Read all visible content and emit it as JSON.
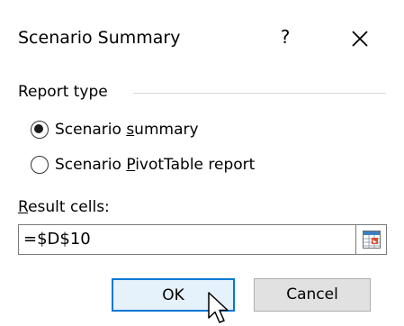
{
  "dialog": {
    "title": "Scenario Summary",
    "help_label": "?",
    "close_icon": "close-icon"
  },
  "report_type": {
    "group_label": "Report type",
    "options": [
      {
        "label": "Scenario summary",
        "underlined_char": "s",
        "selected": true
      },
      {
        "label": "Scenario PivotTable report",
        "underlined_char": "P",
        "selected": false
      }
    ]
  },
  "result_cells": {
    "label": "Result cells:",
    "value": "=$D$10",
    "collapse_icon": "range-selector-icon"
  },
  "buttons": {
    "ok_label": "OK",
    "cancel_label": "Cancel"
  },
  "colors": {
    "ok_border": "#0078d7",
    "ok_fill": "#e5f1fb",
    "cancel_fill": "#e1e1e1"
  }
}
